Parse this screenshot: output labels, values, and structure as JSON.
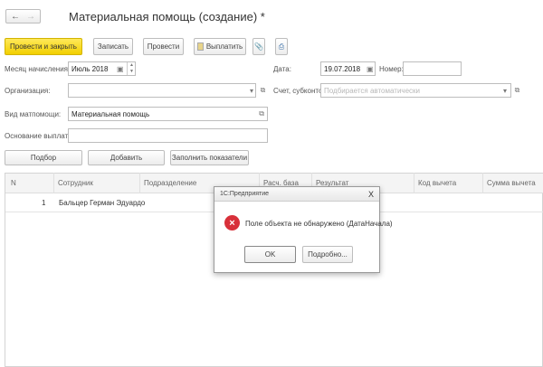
{
  "title": "Материальная помощь (создание) *",
  "toolbar": {
    "post_close": "Провести и закрыть",
    "save": "Записать",
    "post": "Провести",
    "pay": "Выплатить"
  },
  "form": {
    "month_label": "Месяц начисления:",
    "month_value": "Июль 2018",
    "date_label": "Дата:",
    "date_value": "19.07.2018",
    "number_label": "Номер:",
    "number_value": "",
    "org_label": "Организация:",
    "org_value": "",
    "account_label": "Счет, субконто:",
    "account_placeholder": "Подбирается автоматически",
    "type_label": "Вид матпомощи:",
    "type_value": "Материальная помощь",
    "basis_label": "Основание выплаты:",
    "basis_value": ""
  },
  "table_buttons": {
    "pick": "Подбор",
    "add": "Добавить",
    "fill": "Заполнить показатели"
  },
  "table": {
    "columns": [
      "N",
      "Сотрудник",
      "Подразделение",
      "Расч. база",
      "Результат",
      "Код вычета",
      "Сумма вычета"
    ],
    "rows": [
      {
        "n": "1",
        "employee": "Бальцер Герман Эдуардо"
      }
    ]
  },
  "dialog": {
    "title": "1С:Предприятие",
    "close": "X",
    "message": "Поле объекта не обнаружено (ДатаНачала)",
    "ok": "OK",
    "details": "Подробно..."
  }
}
